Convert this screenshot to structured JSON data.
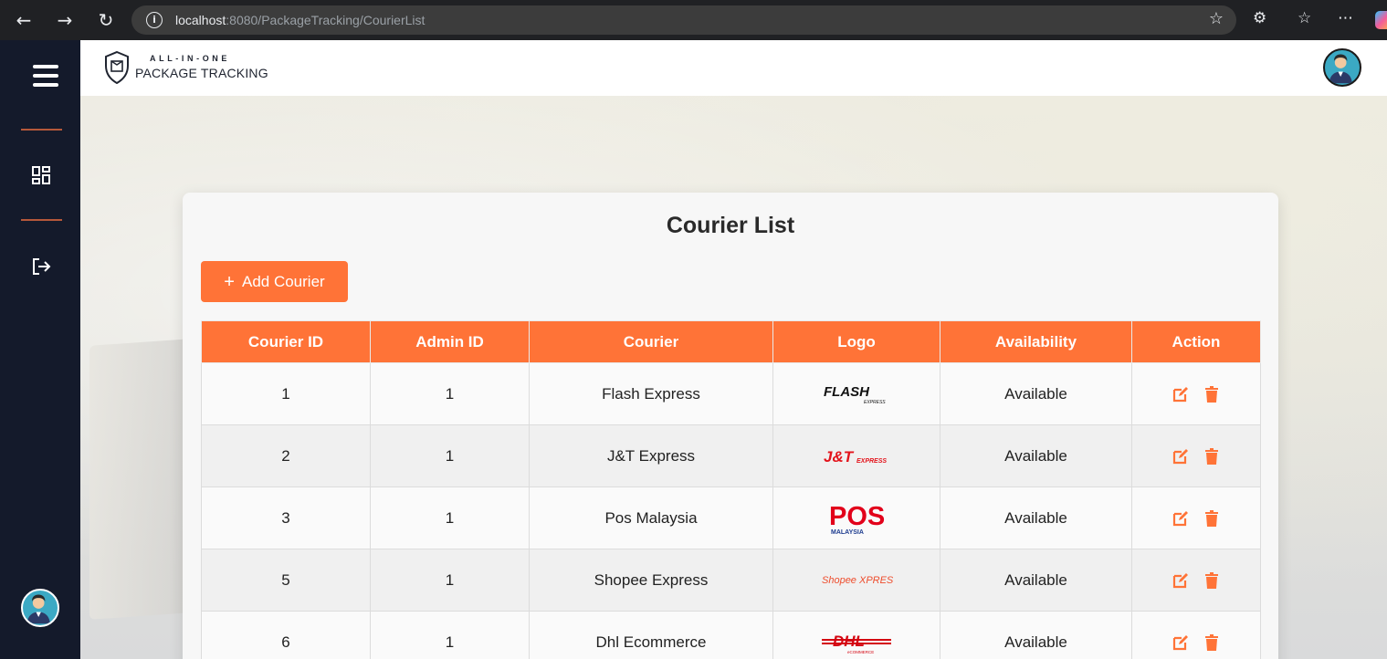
{
  "browser": {
    "url_host": "localhost",
    "url_rest": ":8080/PackageTracking/CourierList"
  },
  "brand": {
    "top": "ALL-IN-ONE",
    "bottom": "PACKAGE TRACKING"
  },
  "page": {
    "title": "Courier List",
    "add_button": "Add Courier"
  },
  "table": {
    "headers": [
      "Courier ID",
      "Admin ID",
      "Courier",
      "Logo",
      "Availability",
      "Action"
    ],
    "rows": [
      {
        "courier_id": "1",
        "admin_id": "1",
        "courier": "Flash Express",
        "logo": "FLASH",
        "availability": "Available"
      },
      {
        "courier_id": "2",
        "admin_id": "1",
        "courier": "J&T Express",
        "logo": "J&T",
        "availability": "Available"
      },
      {
        "courier_id": "3",
        "admin_id": "1",
        "courier": "Pos Malaysia",
        "logo": "POS",
        "availability": "Available"
      },
      {
        "courier_id": "5",
        "admin_id": "1",
        "courier": "Shopee Express",
        "logo": "Shopee XPRESS",
        "availability": "Available"
      },
      {
        "courier_id": "6",
        "admin_id": "1",
        "courier": "Dhl Ecommerce",
        "logo": "DHL",
        "availability": "Available"
      }
    ]
  },
  "logo_sub": {
    "flash": "EXPRESS",
    "jt": "EXPRESS",
    "pos": "MALAYSIA",
    "dhl": "eCOMMERCE"
  },
  "colors": {
    "accent": "#ff7337",
    "sidebar": "#141a2b"
  }
}
